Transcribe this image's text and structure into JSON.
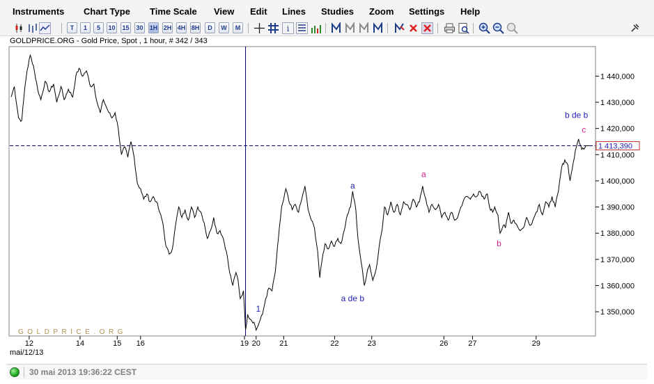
{
  "menu": [
    "Instruments",
    "Chart Type",
    "Time Scale",
    "View",
    "Edit",
    "Lines",
    "Studies",
    "Zoom",
    "Settings",
    "Help"
  ],
  "toolbar": {
    "scale_buttons": [
      "T",
      "1",
      "5",
      "10",
      "15",
      "30",
      "1H",
      "2H",
      "4H",
      "8H",
      "D",
      "W",
      "M"
    ],
    "active_scale": "1H"
  },
  "chart_title": "GOLDPRICE.ORG - Gold Price, Spot , 1 hour, # 342 / 343",
  "watermark": "GOLDPRICE.ORG",
  "date_label": "mai/12/13",
  "status": {
    "timestamp": "30 mai 2013 19:36:22 CEST"
  },
  "colors": {
    "price_line": "#000000",
    "crosshair": "#00007f",
    "wave_blue": "#1e1eb4",
    "wave_magenta": "#d21e8c",
    "last_price_bg": "#ffffff"
  },
  "chart_data": {
    "type": "line",
    "ylim": [
      1341000,
      1451000
    ],
    "y_ticks": [
      1350000,
      1360000,
      1370000,
      1380000,
      1390000,
      1400000,
      1410000,
      1420000,
      1430000,
      1440000
    ],
    "y_tick_labels": [
      "1 350,000",
      "1 360,000",
      "1 370,000",
      "1 380,000",
      "1 390,000",
      "1 400,000",
      "1 410,000",
      "1 420,000",
      "1 430,000",
      "1 440,000"
    ],
    "x_tick_labels": [
      {
        "label": "12",
        "index": 17
      },
      {
        "label": "14",
        "index": 65
      },
      {
        "label": "15",
        "index": 100
      },
      {
        "label": "16",
        "index": 122
      },
      {
        "label": "19",
        "index": 220
      },
      {
        "label": "20",
        "index": 231
      },
      {
        "label": "21",
        "index": 257
      },
      {
        "label": "22",
        "index": 305
      },
      {
        "label": "23",
        "index": 340
      },
      {
        "label": "26",
        "index": 408
      },
      {
        "label": "27",
        "index": 435
      },
      {
        "label": "29",
        "index": 495
      }
    ],
    "last_price": 1413390,
    "last_price_label": "1 413,390",
    "crosshair_index": 221,
    "annotations": [
      {
        "text": "1",
        "index": 233,
        "price": 1350000,
        "color": "blue"
      },
      {
        "text": "a",
        "index": 322,
        "price": 1397000,
        "color": "blue"
      },
      {
        "text": "a de b",
        "index": 322,
        "price": 1354000,
        "color": "blue"
      },
      {
        "text": "a",
        "index": 389,
        "price": 1401500,
        "color": "magenta"
      },
      {
        "text": "b",
        "index": 460,
        "price": 1375000,
        "color": "magenta"
      },
      {
        "text": "b de b",
        "index": 533,
        "price": 1424000,
        "color": "blue"
      },
      {
        "text": "c",
        "index": 540,
        "price": 1418500,
        "color": "magenta"
      }
    ],
    "x_count": 550,
    "anchors": [
      [
        0,
        1432000
      ],
      [
        3,
        1436000
      ],
      [
        7,
        1424000
      ],
      [
        10,
        1423000
      ],
      [
        13,
        1436000
      ],
      [
        15,
        1442000
      ],
      [
        18,
        1448000
      ],
      [
        21,
        1444000
      ],
      [
        25,
        1435000
      ],
      [
        28,
        1431000
      ],
      [
        32,
        1438000
      ],
      [
        36,
        1434000
      ],
      [
        40,
        1437000
      ],
      [
        43,
        1430000
      ],
      [
        47,
        1436000
      ],
      [
        50,
        1431000
      ],
      [
        54,
        1435000
      ],
      [
        58,
        1432000
      ],
      [
        61,
        1440000
      ],
      [
        64,
        1443000
      ],
      [
        67,
        1440000
      ],
      [
        71,
        1442000
      ],
      [
        75,
        1436000
      ],
      [
        78,
        1437000
      ],
      [
        81,
        1430000
      ],
      [
        84,
        1426000
      ],
      [
        87,
        1431000
      ],
      [
        91,
        1427000
      ],
      [
        95,
        1424000
      ],
      [
        98,
        1426000
      ],
      [
        101,
        1420000
      ],
      [
        104,
        1410000
      ],
      [
        107,
        1413000
      ],
      [
        110,
        1409000
      ],
      [
        113,
        1415000
      ],
      [
        116,
        1409000
      ],
      [
        119,
        1399000
      ],
      [
        122,
        1397000
      ],
      [
        125,
        1393000
      ],
      [
        128,
        1395000
      ],
      [
        131,
        1392000
      ],
      [
        134,
        1394000
      ],
      [
        137,
        1392000
      ],
      [
        140,
        1388000
      ],
      [
        143,
        1384000
      ],
      [
        146,
        1375000
      ],
      [
        149,
        1372000
      ],
      [
        152,
        1374000
      ],
      [
        155,
        1383000
      ],
      [
        158,
        1390000
      ],
      [
        161,
        1386000
      ],
      [
        164,
        1389000
      ],
      [
        167,
        1385000
      ],
      [
        170,
        1390000
      ],
      [
        173,
        1386000
      ],
      [
        176,
        1390000
      ],
      [
        179,
        1388000
      ],
      [
        182,
        1384000
      ],
      [
        185,
        1378000
      ],
      [
        188,
        1381000
      ],
      [
        191,
        1386000
      ],
      [
        194,
        1380000
      ],
      [
        197,
        1381000
      ],
      [
        200,
        1378000
      ],
      [
        203,
        1373000
      ],
      [
        206,
        1365000
      ],
      [
        209,
        1360000
      ],
      [
        212,
        1365000
      ],
      [
        214,
        1362000
      ],
      [
        216,
        1355000
      ],
      [
        219,
        1358000
      ],
      [
        221,
        1343000
      ],
      [
        223,
        1349000
      ],
      [
        226,
        1347000
      ],
      [
        229,
        1346000
      ],
      [
        231,
        1343000
      ],
      [
        234,
        1346000
      ],
      [
        237,
        1349000
      ],
      [
        240,
        1355000
      ],
      [
        243,
        1359000
      ],
      [
        246,
        1358000
      ],
      [
        249,
        1365000
      ],
      [
        252,
        1378000
      ],
      [
        255,
        1390000
      ],
      [
        257,
        1393000
      ],
      [
        259,
        1397000
      ],
      [
        262,
        1392000
      ],
      [
        265,
        1389000
      ],
      [
        268,
        1391000
      ],
      [
        271,
        1388000
      ],
      [
        274,
        1393000
      ],
      [
        277,
        1398000
      ],
      [
        280,
        1389000
      ],
      [
        283,
        1385000
      ],
      [
        286,
        1382000
      ],
      [
        289,
        1373000
      ],
      [
        291,
        1363000
      ],
      [
        294,
        1372000
      ],
      [
        296,
        1376000
      ],
      [
        299,
        1374000
      ],
      [
        302,
        1377000
      ],
      [
        305,
        1375000
      ],
      [
        308,
        1378000
      ],
      [
        311,
        1376000
      ],
      [
        314,
        1381000
      ],
      [
        317,
        1387000
      ],
      [
        320,
        1390000
      ],
      [
        322,
        1396000
      ],
      [
        325,
        1389000
      ],
      [
        327,
        1378000
      ],
      [
        330,
        1369000
      ],
      [
        333,
        1360000
      ],
      [
        336,
        1366000
      ],
      [
        338,
        1368000
      ],
      [
        341,
        1362000
      ],
      [
        344,
        1366000
      ],
      [
        347,
        1375000
      ],
      [
        350,
        1382000
      ],
      [
        352,
        1390000
      ],
      [
        355,
        1387000
      ],
      [
        358,
        1392000
      ],
      [
        361,
        1388000
      ],
      [
        364,
        1391000
      ],
      [
        367,
        1387000
      ],
      [
        370,
        1392000
      ],
      [
        373,
        1391000
      ],
      [
        376,
        1389000
      ],
      [
        379,
        1393000
      ],
      [
        382,
        1390000
      ],
      [
        385,
        1392000
      ],
      [
        388,
        1398000
      ],
      [
        391,
        1393000
      ],
      [
        394,
        1388000
      ],
      [
        397,
        1391000
      ],
      [
        400,
        1389000
      ],
      [
        403,
        1391000
      ],
      [
        406,
        1386000
      ],
      [
        409,
        1388000
      ],
      [
        412,
        1385000
      ],
      [
        415,
        1388000
      ],
      [
        418,
        1385000
      ],
      [
        421,
        1386000
      ],
      [
        424,
        1390000
      ],
      [
        427,
        1393000
      ],
      [
        430,
        1394000
      ],
      [
        433,
        1393000
      ],
      [
        436,
        1395000
      ],
      [
        439,
        1394000
      ],
      [
        442,
        1396000
      ],
      [
        444,
        1394000
      ],
      [
        446,
        1393000
      ],
      [
        449,
        1395000
      ],
      [
        451,
        1390000
      ],
      [
        454,
        1388000
      ],
      [
        456,
        1390000
      ],
      [
        459,
        1387000
      ],
      [
        461,
        1380000
      ],
      [
        464,
        1383000
      ],
      [
        466,
        1382000
      ],
      [
        469,
        1388000
      ],
      [
        471,
        1384000
      ],
      [
        474,
        1385000
      ],
      [
        477,
        1383000
      ],
      [
        480,
        1381000
      ],
      [
        483,
        1382000
      ],
      [
        486,
        1386000
      ],
      [
        489,
        1383000
      ],
      [
        492,
        1385000
      ],
      [
        495,
        1388000
      ],
      [
        498,
        1391000
      ],
      [
        501,
        1387000
      ],
      [
        504,
        1392000
      ],
      [
        507,
        1390000
      ],
      [
        510,
        1394000
      ],
      [
        513,
        1390000
      ],
      [
        516,
        1396000
      ],
      [
        519,
        1405000
      ],
      [
        522,
        1408000
      ],
      [
        525,
        1406000
      ],
      [
        527,
        1400000
      ],
      [
        530,
        1407000
      ],
      [
        533,
        1413000
      ],
      [
        535,
        1416000
      ],
      [
        538,
        1412000
      ],
      [
        542,
        1413390
      ]
    ]
  }
}
